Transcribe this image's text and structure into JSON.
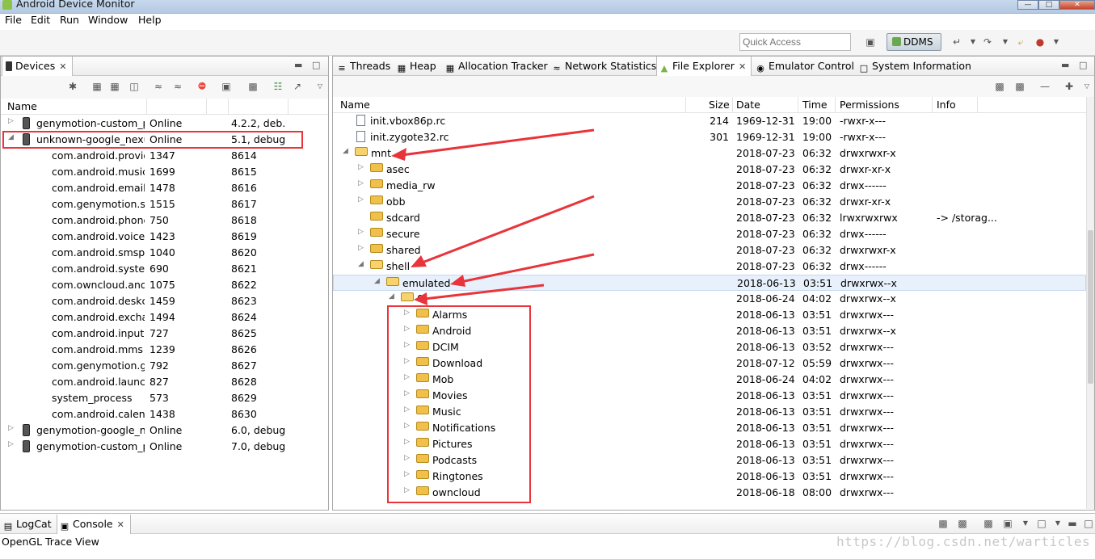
{
  "window": {
    "title": "Android Device Monitor"
  },
  "menu": [
    "File",
    "Edit",
    "Run",
    "Window",
    "Help"
  ],
  "toolbar": {
    "quick_access_placeholder": "Quick Access",
    "perspective_label": "DDMS"
  },
  "devices_view": {
    "tab_label": "Devices",
    "columns": [
      "Name"
    ],
    "rows": [
      {
        "name": "genymotion-custom_ph",
        "status": "Online",
        "extra": "4.2.2, deb...",
        "kind": "device",
        "expanded": false
      },
      {
        "name": "unknown-google_nexus",
        "status": "Online",
        "extra": "5.1, debug",
        "kind": "device",
        "expanded": true
      },
      {
        "name": "com.android.provid",
        "status": "1347",
        "extra": "8614",
        "kind": "process"
      },
      {
        "name": "com.android.musicf",
        "status": "1699",
        "extra": "8615",
        "kind": "process"
      },
      {
        "name": "com.android.email",
        "status": "1478",
        "extra": "8616",
        "kind": "process"
      },
      {
        "name": "com.genymotion.su",
        "status": "1515",
        "extra": "8617",
        "kind": "process"
      },
      {
        "name": "com.android.phone",
        "status": "750",
        "extra": "8618",
        "kind": "process"
      },
      {
        "name": "com.android.voiced",
        "status": "1423",
        "extra": "8619",
        "kind": "process"
      },
      {
        "name": "com.android.smspu",
        "status": "1040",
        "extra": "8620",
        "kind": "process"
      },
      {
        "name": "com.android.system",
        "status": "690",
        "extra": "8621",
        "kind": "process"
      },
      {
        "name": "com.owncloud.andr",
        "status": "1075",
        "extra": "8622",
        "kind": "process"
      },
      {
        "name": "com.android.deskcl",
        "status": "1459",
        "extra": "8623",
        "kind": "process"
      },
      {
        "name": "com.android.exchar",
        "status": "1494",
        "extra": "8624",
        "kind": "process"
      },
      {
        "name": "com.android.inputm",
        "status": "727",
        "extra": "8625",
        "kind": "process"
      },
      {
        "name": "com.android.mms",
        "status": "1239",
        "extra": "8626",
        "kind": "process"
      },
      {
        "name": "com.genymotion.ge",
        "status": "792",
        "extra": "8627",
        "kind": "process"
      },
      {
        "name": "com.android.launch",
        "status": "827",
        "extra": "8628",
        "kind": "process"
      },
      {
        "name": "system_process",
        "status": "573",
        "extra": "8629",
        "kind": "process"
      },
      {
        "name": "com.android.calend",
        "status": "1438",
        "extra": "8630",
        "kind": "process"
      },
      {
        "name": "genymotion-google_ne",
        "status": "Online",
        "extra": "6.0, debug",
        "kind": "device",
        "expanded": false
      },
      {
        "name": "genymotion-custom_ph",
        "status": "Online",
        "extra": "7.0, debug",
        "kind": "device",
        "expanded": false
      }
    ]
  },
  "right_tabs": [
    "Threads",
    "Heap",
    "Allocation Tracker",
    "Network Statistics",
    "File Explorer",
    "Emulator Control",
    "System Information"
  ],
  "file_explorer": {
    "columns": [
      "Name",
      "Size",
      "Date",
      "Time",
      "Permissions",
      "Info"
    ],
    "rows": [
      {
        "depth": 0,
        "type": "file",
        "name": "init.vbox86p.rc",
        "size": "214",
        "date": "1969-12-31",
        "time": "19:00",
        "perm": "-rwxr-x---",
        "info": ""
      },
      {
        "depth": 0,
        "type": "file",
        "name": "init.zygote32.rc",
        "size": "301",
        "date": "1969-12-31",
        "time": "19:00",
        "perm": "-rwxr-x---",
        "info": ""
      },
      {
        "depth": 0,
        "type": "dir",
        "open": true,
        "name": "mnt",
        "size": "",
        "date": "2018-07-23",
        "time": "06:32",
        "perm": "drwxrwxr-x",
        "info": ""
      },
      {
        "depth": 1,
        "type": "dir",
        "open": false,
        "name": "asec",
        "size": "",
        "date": "2018-07-23",
        "time": "06:32",
        "perm": "drwxr-xr-x",
        "info": ""
      },
      {
        "depth": 1,
        "type": "dir",
        "open": false,
        "name": "media_rw",
        "size": "",
        "date": "2018-07-23",
        "time": "06:32",
        "perm": "drwx------",
        "info": ""
      },
      {
        "depth": 1,
        "type": "dir",
        "open": false,
        "name": "obb",
        "size": "",
        "date": "2018-07-23",
        "time": "06:32",
        "perm": "drwxr-xr-x",
        "info": ""
      },
      {
        "depth": 1,
        "type": "link",
        "open": false,
        "name": "sdcard",
        "size": "",
        "date": "2018-07-23",
        "time": "06:32",
        "perm": "lrwxrwxrwx",
        "info": "-> /storag..."
      },
      {
        "depth": 1,
        "type": "dir",
        "open": false,
        "name": "secure",
        "size": "",
        "date": "2018-07-23",
        "time": "06:32",
        "perm": "drwx------",
        "info": ""
      },
      {
        "depth": 1,
        "type": "dir",
        "open": false,
        "name": "shared",
        "size": "",
        "date": "2018-07-23",
        "time": "06:32",
        "perm": "drwxrwxr-x",
        "info": ""
      },
      {
        "depth": 1,
        "type": "dir",
        "open": true,
        "name": "shell",
        "size": "",
        "date": "2018-07-23",
        "time": "06:32",
        "perm": "drwx------",
        "info": ""
      },
      {
        "depth": 2,
        "type": "dir",
        "open": true,
        "name": "emulated",
        "size": "",
        "date": "2018-06-13",
        "time": "03:51",
        "perm": "drwxrwx--x",
        "info": "",
        "selected": true
      },
      {
        "depth": 3,
        "type": "dir",
        "open": true,
        "name": "0",
        "size": "",
        "date": "2018-06-24",
        "time": "04:02",
        "perm": "drwxrwx--x",
        "info": ""
      },
      {
        "depth": 4,
        "type": "dir",
        "open": false,
        "name": "Alarms",
        "size": "",
        "date": "2018-06-13",
        "time": "03:51",
        "perm": "drwxrwx---",
        "info": ""
      },
      {
        "depth": 4,
        "type": "dir",
        "open": false,
        "name": "Android",
        "size": "",
        "date": "2018-06-13",
        "time": "03:51",
        "perm": "drwxrwx--x",
        "info": ""
      },
      {
        "depth": 4,
        "type": "dir",
        "open": false,
        "name": "DCIM",
        "size": "",
        "date": "2018-06-13",
        "time": "03:52",
        "perm": "drwxrwx---",
        "info": ""
      },
      {
        "depth": 4,
        "type": "dir",
        "open": false,
        "name": "Download",
        "size": "",
        "date": "2018-07-12",
        "time": "05:59",
        "perm": "drwxrwx---",
        "info": ""
      },
      {
        "depth": 4,
        "type": "dir",
        "open": false,
        "name": "Mob",
        "size": "",
        "date": "2018-06-24",
        "time": "04:02",
        "perm": "drwxrwx---",
        "info": ""
      },
      {
        "depth": 4,
        "type": "dir",
        "open": false,
        "name": "Movies",
        "size": "",
        "date": "2018-06-13",
        "time": "03:51",
        "perm": "drwxrwx---",
        "info": ""
      },
      {
        "depth": 4,
        "type": "dir",
        "open": false,
        "name": "Music",
        "size": "",
        "date": "2018-06-13",
        "time": "03:51",
        "perm": "drwxrwx---",
        "info": ""
      },
      {
        "depth": 4,
        "type": "dir",
        "open": false,
        "name": "Notifications",
        "size": "",
        "date": "2018-06-13",
        "time": "03:51",
        "perm": "drwxrwx---",
        "info": ""
      },
      {
        "depth": 4,
        "type": "dir",
        "open": false,
        "name": "Pictures",
        "size": "",
        "date": "2018-06-13",
        "time": "03:51",
        "perm": "drwxrwx---",
        "info": ""
      },
      {
        "depth": 4,
        "type": "dir",
        "open": false,
        "name": "Podcasts",
        "size": "",
        "date": "2018-06-13",
        "time": "03:51",
        "perm": "drwxrwx---",
        "info": ""
      },
      {
        "depth": 4,
        "type": "dir",
        "open": false,
        "name": "Ringtones",
        "size": "",
        "date": "2018-06-13",
        "time": "03:51",
        "perm": "drwxrwx---",
        "info": ""
      },
      {
        "depth": 4,
        "type": "dir",
        "open": false,
        "name": "owncloud",
        "size": "",
        "date": "2018-06-18",
        "time": "08:00",
        "perm": "drwxrwx---",
        "info": ""
      }
    ]
  },
  "bottom": {
    "tabs": [
      "LogCat",
      "Console"
    ],
    "status_text": "OpenGL Trace View"
  },
  "watermark": "https://blog.csdn.net/warticles",
  "colors": {
    "annotation_red": "#e8343a",
    "selected_row": "#e8f0fb",
    "folder": "#f0c04a"
  }
}
